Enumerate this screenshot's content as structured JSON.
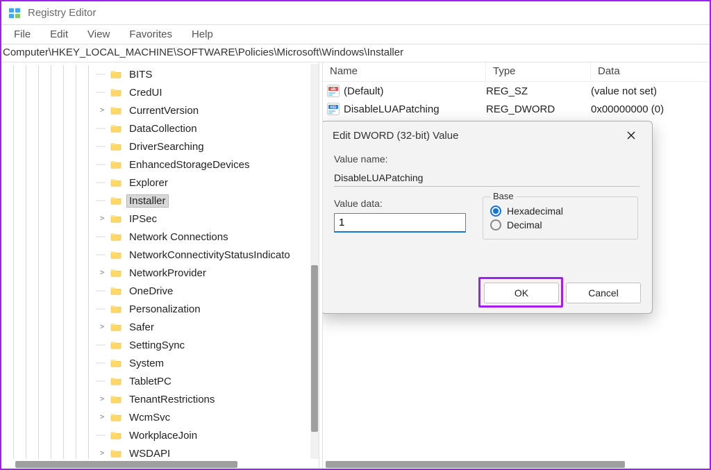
{
  "title": "Registry Editor",
  "menu": [
    "File",
    "Edit",
    "View",
    "Favorites",
    "Help"
  ],
  "address": "Computer\\HKEY_LOCAL_MACHINE\\SOFTWARE\\Policies\\Microsoft\\Windows\\Installer",
  "selected_key": "Installer",
  "tree_nodes": [
    {
      "name": "BITS",
      "expandable": false
    },
    {
      "name": "CredUI",
      "expandable": false
    },
    {
      "name": "CurrentVersion",
      "expandable": true
    },
    {
      "name": "DataCollection",
      "expandable": false
    },
    {
      "name": "DriverSearching",
      "expandable": false
    },
    {
      "name": "EnhancedStorageDevices",
      "expandable": false
    },
    {
      "name": "Explorer",
      "expandable": false
    },
    {
      "name": "Installer",
      "expandable": false,
      "selected": true
    },
    {
      "name": "IPSec",
      "expandable": true
    },
    {
      "name": "Network Connections",
      "expandable": false
    },
    {
      "name": "NetworkConnectivityStatusIndicato",
      "expandable": false
    },
    {
      "name": "NetworkProvider",
      "expandable": true
    },
    {
      "name": "OneDrive",
      "expandable": false
    },
    {
      "name": "Personalization",
      "expandable": false
    },
    {
      "name": "Safer",
      "expandable": true
    },
    {
      "name": "SettingSync",
      "expandable": false
    },
    {
      "name": "System",
      "expandable": false
    },
    {
      "name": "TabletPC",
      "expandable": false
    },
    {
      "name": "TenantRestrictions",
      "expandable": true
    },
    {
      "name": "WcmSvc",
      "expandable": true
    },
    {
      "name": "WorkplaceJoin",
      "expandable": false
    },
    {
      "name": "WSDAPI",
      "expandable": true
    }
  ],
  "columns": {
    "name": "Name",
    "type": "Type",
    "data": "Data"
  },
  "values": [
    {
      "kind": "sz",
      "name": "(Default)",
      "type": "REG_SZ",
      "data": "(value not set)"
    },
    {
      "kind": "dword",
      "name": "DisableLUAPatching",
      "type": "REG_DWORD",
      "data": "0x00000000 (0)"
    }
  ],
  "dialog": {
    "title": "Edit DWORD (32-bit) Value",
    "label_valuename": "Value name:",
    "value_name": "DisableLUAPatching",
    "label_valuedata": "Value data:",
    "value_data": "1",
    "group_base": "Base",
    "opt_hex": "Hexadecimal",
    "opt_dec": "Decimal",
    "base_selected": "hex",
    "btn_ok": "OK",
    "btn_cancel": "Cancel"
  }
}
